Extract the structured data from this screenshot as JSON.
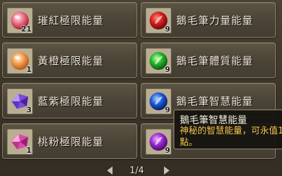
{
  "items": [
    {
      "name": "璀紅極限能量",
      "qty": "21",
      "icon": "red-pearl-orb-icon"
    },
    {
      "name": "鵝毛筆力量能量",
      "qty": "9",
      "icon": "red-quill-orb-icon"
    },
    {
      "name": "黃橙極限能量",
      "qty": "1",
      "icon": "orange-pearl-orb-icon"
    },
    {
      "name": "鵝毛筆體質能量",
      "qty": "9",
      "icon": "green-quill-orb-icon"
    },
    {
      "name": "藍紫極限能量",
      "qty": "3",
      "icon": "purple-crystal-icon"
    },
    {
      "name": "鵝毛筆智慧能量",
      "qty": "9",
      "icon": "blue-quill-orb-icon"
    },
    {
      "name": "桃粉極限能量",
      "qty": "1",
      "icon": "pink-crystal-icon"
    },
    {
      "name": "",
      "qty": "9",
      "icon": "purple-quill-orb-icon"
    }
  ],
  "pager": {
    "text": "1/4"
  },
  "tooltip": {
    "title": "鵝毛筆智慧能量",
    "description": "神秘的智慧能量，可永值1點。"
  },
  "colors": {
    "tooltip_desc": "#f2c24b",
    "label": "#efe8d8",
    "slot_border": "#8a7e68"
  }
}
